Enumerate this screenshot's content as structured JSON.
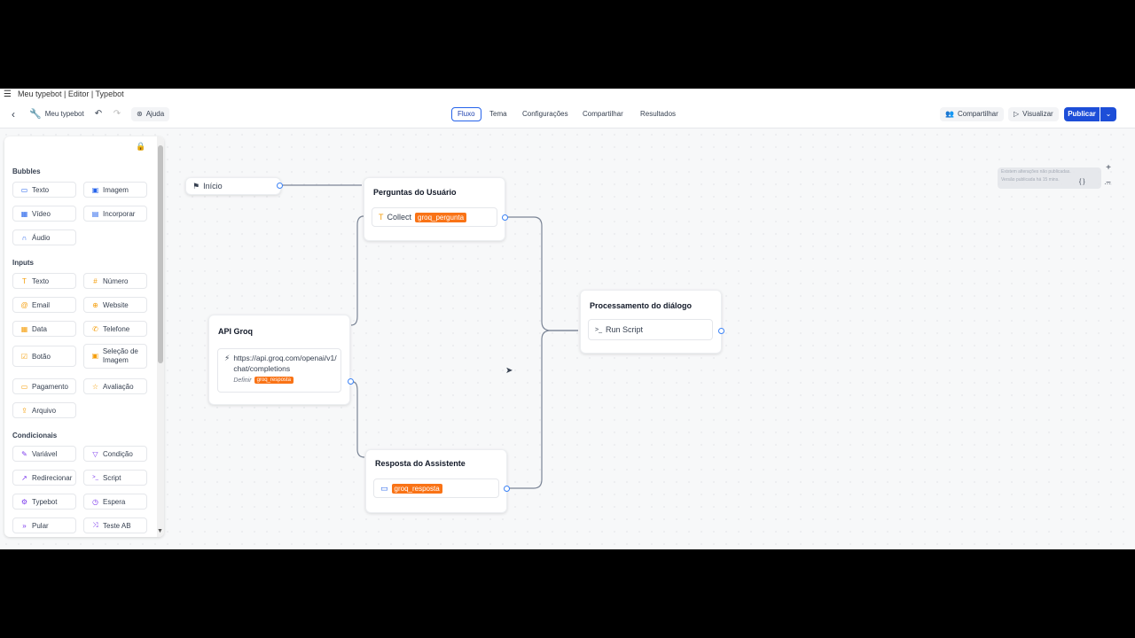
{
  "window": {
    "title": "Meu typebot | Editor | Typebot"
  },
  "header": {
    "bot_name": "Meu typebot",
    "help_label": "Ajuda",
    "tabs": [
      {
        "label": "Fluxo"
      },
      {
        "label": "Tema"
      },
      {
        "label": "Configurações"
      },
      {
        "label": "Compartilhar"
      },
      {
        "label": "Resultados"
      }
    ],
    "share_label": "Compartilhar",
    "preview_label": "Visualizar",
    "publish_label": "Publicar"
  },
  "sidebar": {
    "sections": [
      {
        "title": "Bubbles",
        "items": [
          {
            "label": "Texto",
            "icon": "chat-bubble-icon"
          },
          {
            "label": "Imagem",
            "icon": "image-icon"
          },
          {
            "label": "Vídeo",
            "icon": "video-icon"
          },
          {
            "label": "Incorporar",
            "icon": "embed-icon"
          },
          {
            "label": "Áudio",
            "icon": "headphones-icon"
          }
        ]
      },
      {
        "title": "Inputs",
        "items": [
          {
            "label": "Texto",
            "icon": "text-cursor-icon"
          },
          {
            "label": "Número",
            "icon": "hash-icon"
          },
          {
            "label": "Email",
            "icon": "at-sign-icon"
          },
          {
            "label": "Website",
            "icon": "globe-icon"
          },
          {
            "label": "Data",
            "icon": "calendar-icon"
          },
          {
            "label": "Telefone",
            "icon": "phone-icon"
          },
          {
            "label": "Botão",
            "icon": "check-square-icon"
          },
          {
            "label": "Seleção de Imagem",
            "icon": "image-select-icon"
          },
          {
            "label": "Pagamento",
            "icon": "credit-card-icon"
          },
          {
            "label": "Avaliação",
            "icon": "star-icon"
          },
          {
            "label": "Arquivo",
            "icon": "upload-icon"
          }
        ]
      },
      {
        "title": "Condicionais",
        "items": [
          {
            "label": "Variável",
            "icon": "pencil-icon"
          },
          {
            "label": "Condição",
            "icon": "filter-icon"
          },
          {
            "label": "Redirecionar",
            "icon": "external-link-icon"
          },
          {
            "label": "Script",
            "icon": "terminal-icon"
          },
          {
            "label": "Typebot",
            "icon": "typebot-icon"
          },
          {
            "label": "Espera",
            "icon": "clock-icon"
          },
          {
            "label": "Pular",
            "icon": "fast-forward-icon"
          },
          {
            "label": "Teste AB",
            "icon": "shuffle-icon"
          }
        ]
      }
    ]
  },
  "flow": {
    "start": {
      "label": "Início"
    },
    "user_questions": {
      "title": "Perguntas do Usuário",
      "block_text": "Collect",
      "variable": "groq_pergunta"
    },
    "api": {
      "title": "API Groq",
      "url": "https://api.groq.com/openai/v1/chat/completions",
      "set_label": "Definir",
      "variable": "groq_resposta"
    },
    "processing": {
      "title": "Processamento do diálogo",
      "block_text": "Run Script"
    },
    "response": {
      "title": "Resposta do Assistente",
      "variable": "groq_resposta"
    }
  },
  "toast": {
    "line1": "Existem alterações não publicadas.",
    "line2": "Versão publicada há 15 mins."
  },
  "canvas_controls": {
    "zoom_in": "+",
    "zoom_out": "−",
    "more": "···",
    "code": "{ }"
  }
}
